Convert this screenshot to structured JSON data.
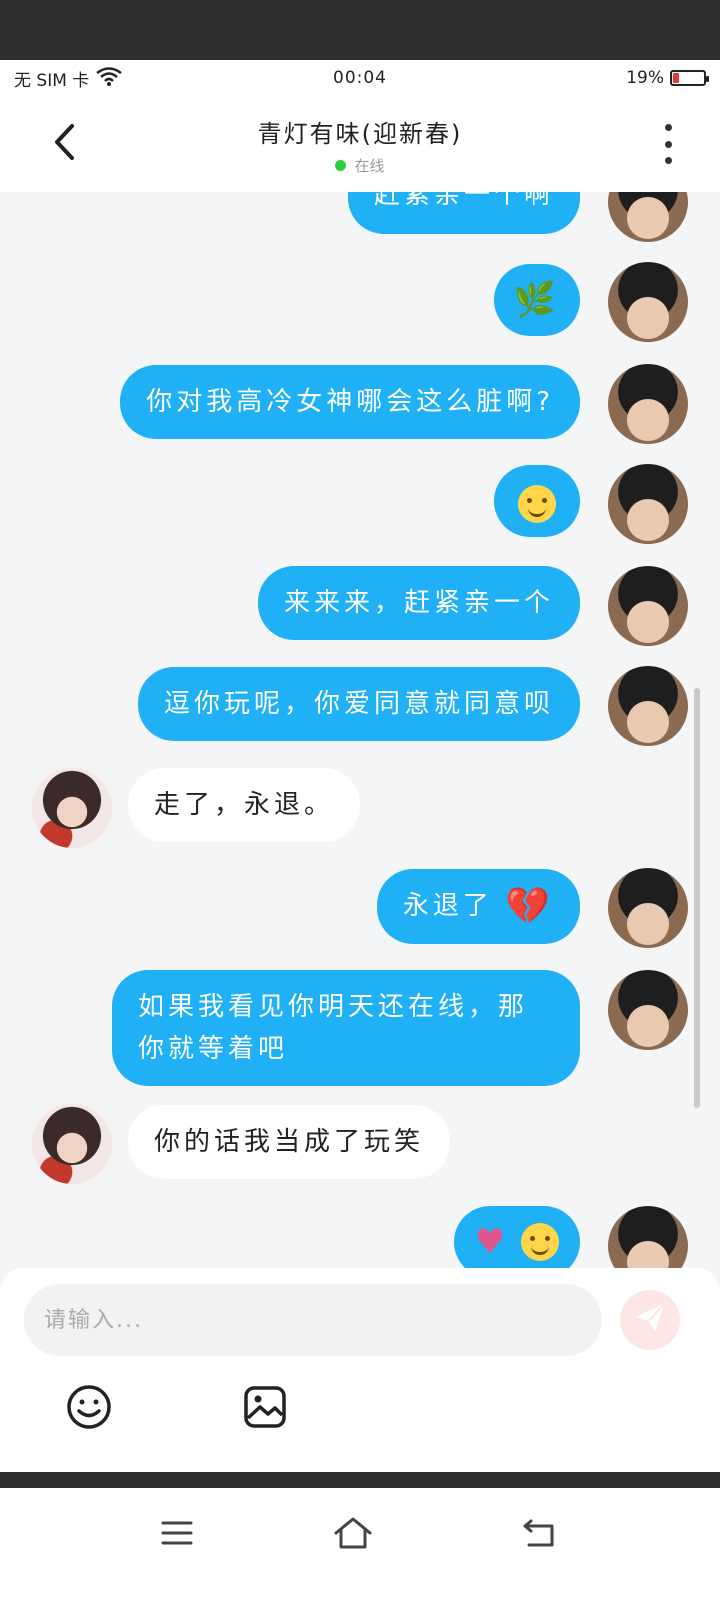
{
  "status_bar": {
    "carrier": "无 SIM 卡",
    "time": "00:04",
    "battery_percent": "19%",
    "battery_level": 0.19,
    "wifi_icon": "wifi-icon"
  },
  "header": {
    "title": "青灯有味(迎新春)",
    "online_status": "在线",
    "back_icon": "chevron-left-icon",
    "more_icon": "more-vertical-icon"
  },
  "messages": [
    {
      "sender": "me",
      "text": "赶紧亲一个啊"
    },
    {
      "sender": "me",
      "emoji": "leaf"
    },
    {
      "sender": "me",
      "text": "你对我高冷女神哪会这么脏啊?"
    },
    {
      "sender": "me",
      "emoji": "smile"
    },
    {
      "sender": "me",
      "text": "来来来，赶紧亲一个"
    },
    {
      "sender": "me",
      "text": "逗你玩呢，你爱同意就同意呗"
    },
    {
      "sender": "her",
      "text": "走了，永退。"
    },
    {
      "sender": "me",
      "text": "永退了",
      "emoji": "broken-heart"
    },
    {
      "sender": "me",
      "text": "如果我看见你明天还在线，那你就等着吧"
    },
    {
      "sender": "her",
      "text": "你的话我当成了玩笑"
    },
    {
      "sender": "me",
      "emoji": "heart-and-wink"
    }
  ],
  "composer": {
    "placeholder": "请输入...",
    "send_icon": "send-icon",
    "emoji_icon": "emoji-icon",
    "image_icon": "image-icon"
  },
  "nav": {
    "menu_icon": "menu-icon",
    "home_icon": "home-icon",
    "back_icon": "back-icon"
  },
  "colors": {
    "my_bubble": "#1fb0f5",
    "their_bubble": "#ffffff",
    "online_dot": "#2ecc40",
    "send_button": "#fde6e3",
    "battery_low": "#e53935"
  }
}
